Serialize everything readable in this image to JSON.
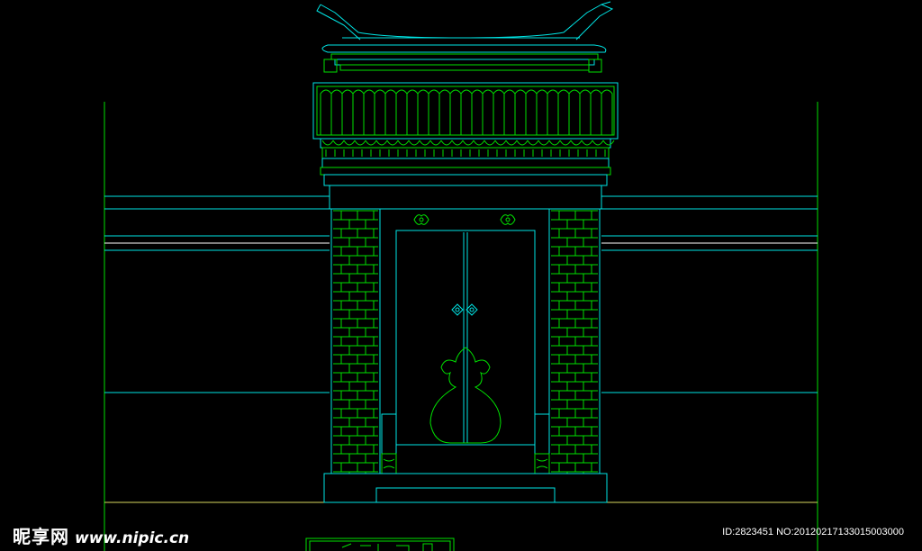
{
  "drawing": {
    "background_color": "#000000",
    "line_colors": {
      "cyan": "#00e5e5",
      "green": "#00e000",
      "yellow": "#d8d860",
      "white": "#ffffff"
    },
    "elements": [
      "roof-ridge",
      "roof-tiles",
      "eave-frieze",
      "brick-pillar-left",
      "brick-pillar-right",
      "double-door",
      "door-knockers",
      "gourd-ornament",
      "base-step",
      "courtyard-wall"
    ]
  },
  "watermark": {
    "brand": "昵享网",
    "url": "www.nipic.cn",
    "id_text": "ID:2823451 NO:20120217133015003000"
  }
}
